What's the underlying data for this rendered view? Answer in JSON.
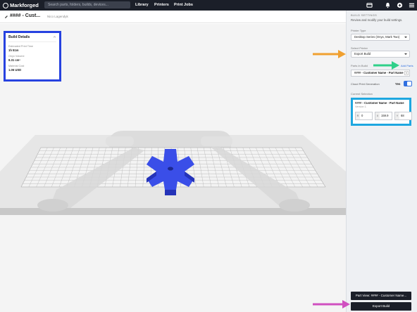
{
  "app": {
    "brand": "Markforged",
    "search_placeholder": "Search parts, folders, builds, devices...",
    "nav": [
      "Library",
      "Printers",
      "Print Jobs"
    ]
  },
  "header": {
    "title": "#### - Cust...",
    "author": "Nico Lagendyk"
  },
  "build_details": {
    "heading": "Build Details",
    "items": [
      {
        "label": "Estimated Print Time",
        "value": "1h 51m"
      },
      {
        "label": "Onyx Volume",
        "value": "8.31 cm³"
      },
      {
        "label": "Material Cost",
        "value": "1.06 USD"
      }
    ]
  },
  "panel": {
    "title": "BUILD SETTINGS",
    "subtitle": "Review and modify your build settings.",
    "printer_type_label": "Printer Type",
    "printer_type_value": "Desktop Series (Onyx, Mark Two)",
    "select_printer_label": "Select Printer",
    "select_printer_value": "Export Build",
    "parts_label": "Parts In Build",
    "add_parts": "Add Parts",
    "part_name": "#### - Customer Name - Part Name",
    "cloud_label": "Cloud Print Generation",
    "cloud_value": "Yes",
    "current_label": "Current Selection",
    "current_name": "#### - Customer Name - Part Name",
    "current_version": "Version 1",
    "coords": [
      {
        "axis": "R",
        "value": "0"
      },
      {
        "axis": "X",
        "value": "159.9"
      },
      {
        "axis": "Y",
        "value": "68"
      }
    ],
    "part_view_button": "Part View: #### - Customer Name...",
    "export_button": "Export Build"
  },
  "colors": {
    "nav_bg": "#1b1f29",
    "details_highlight": "#2742e0",
    "selection_highlight": "#1ea7e0",
    "part": "#3a4ee8",
    "arrow_orange": "#f0a030",
    "arrow_green": "#2fd08a",
    "arrow_pink": "#d050c0"
  }
}
